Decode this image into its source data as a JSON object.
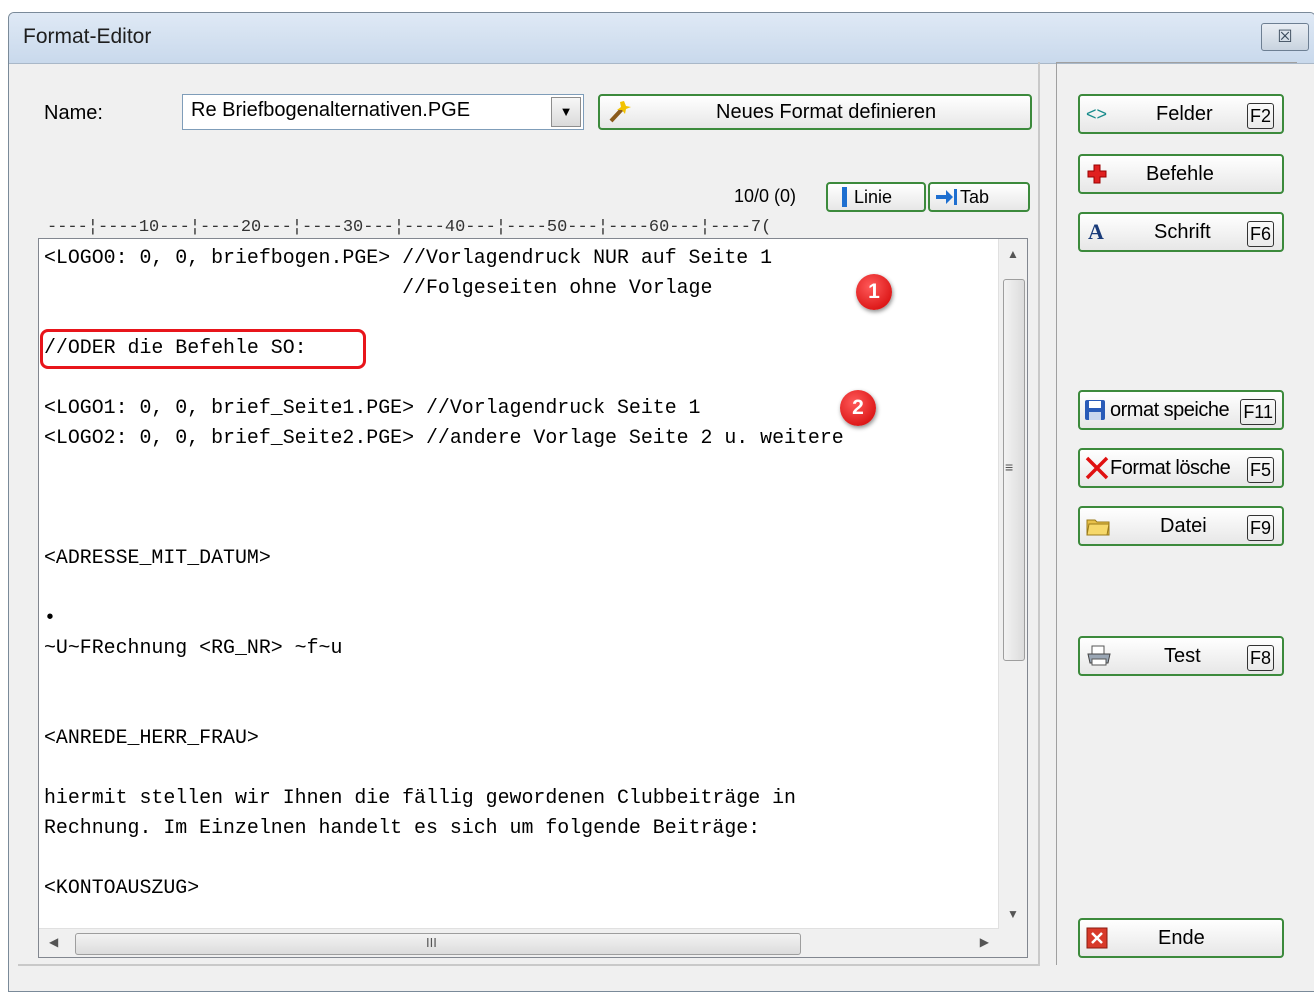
{
  "window": {
    "title": "Format-Editor",
    "close_label": "☒"
  },
  "form": {
    "name_label": "Name:",
    "name_value": "Re Briefbogenalternativen.PGE",
    "new_format_label": "Neues Format definieren",
    "counter": "10/0 (0)",
    "linie_label": "Linie",
    "tab_label": "Tab",
    "ruler": "----¦----10---¦----20---¦----30---¦----40---¦----50---¦----60---¦----7("
  },
  "editor": {
    "lines": [
      "<LOGO0: 0, 0, briefbogen.PGE> //Vorlagendruck NUR auf Seite 1",
      "                              //Folgeseiten ohne Vorlage",
      "",
      "//ODER die Befehle SO:",
      "",
      "<LOGO1: 0, 0, brief_Seite1.PGE> //Vorlagendruck Seite 1",
      "<LOGO2: 0, 0, brief_Seite2.PGE> //andere Vorlage Seite 2 u. weitere",
      "",
      "",
      "",
      "<ADRESSE_MIT_DATUM>",
      "",
      "•",
      "~U~FRechnung <RG_NR> ~f~u",
      "",
      "",
      "<ANREDE_HERR_FRAU>",
      "",
      "hiermit stellen wir Ihnen die fällig gewordenen Clubbeiträge in",
      "Rechnung. Im Einzelnen handelt es sich um folgende Beiträge:",
      "",
      "<KONTOAUSZUG>"
    ],
    "hscroll_grip": "III"
  },
  "annotations": {
    "badge1": "1",
    "badge2": "2"
  },
  "sidebar": {
    "felder": {
      "label": "Felder",
      "key": "F2"
    },
    "befehle": {
      "label": "Befehle"
    },
    "schrift": {
      "label": "Schrift",
      "key": "F6"
    },
    "speichern": {
      "label": "ormat speiche",
      "key": "F11"
    },
    "loeschen": {
      "label": "Format lösche",
      "key": "F5"
    },
    "datei": {
      "label": "Datei",
      "key": "F9"
    },
    "test": {
      "label": "Test",
      "key": "F8"
    },
    "ende": {
      "label": "Ende"
    }
  }
}
